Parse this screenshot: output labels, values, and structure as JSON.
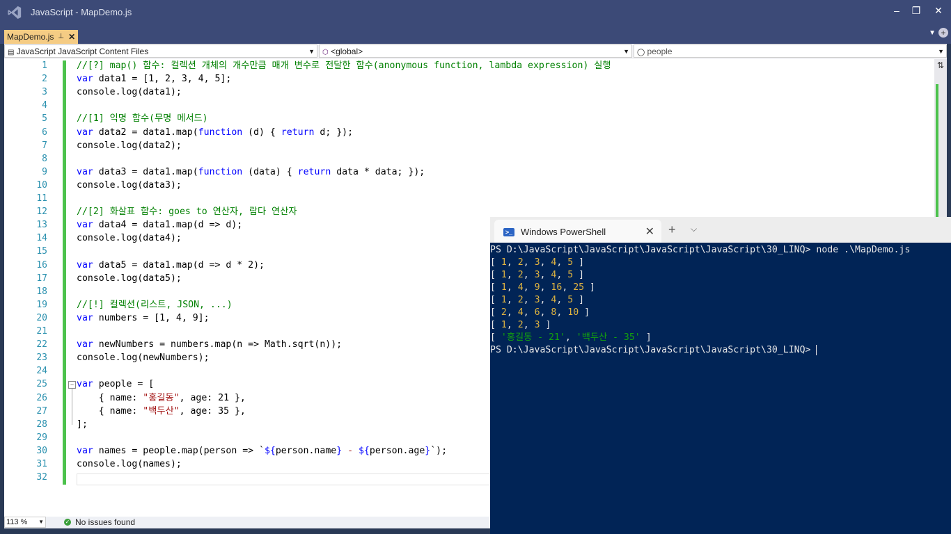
{
  "window": {
    "title": "JavaScript - MapDemo.js"
  },
  "tab": {
    "label": "MapDemo.js",
    "pin": "⊥",
    "close": "✕"
  },
  "navbar": {
    "project": "JavaScript JavaScript Content Files",
    "scope": "<global>",
    "member": "people"
  },
  "editor": {
    "line_numbers": [
      "1",
      "2",
      "3",
      "4",
      "5",
      "6",
      "7",
      "8",
      "9",
      "10",
      "11",
      "12",
      "13",
      "14",
      "15",
      "16",
      "17",
      "18",
      "19",
      "20",
      "21",
      "22",
      "23",
      "24",
      "25",
      "26",
      "27",
      "28",
      "29",
      "30",
      "31",
      "32"
    ],
    "lines": [
      {
        "parts": [
          {
            "t": "//[?] map() 함수: 컬렉션 개체의 개수만큼 매개 변수로 전달한 함수(anonymous function, lambda expression) 실행",
            "c": "cm"
          }
        ]
      },
      {
        "parts": [
          {
            "t": "var",
            "c": "kw"
          },
          {
            "t": " data1 = [1, 2, 3, 4, 5];"
          }
        ]
      },
      {
        "parts": [
          {
            "t": "console.log(data1);"
          }
        ]
      },
      {
        "parts": []
      },
      {
        "parts": [
          {
            "t": "//[1] 익명 함수(무명 메서드)",
            "c": "cm"
          }
        ]
      },
      {
        "parts": [
          {
            "t": "var",
            "c": "kw"
          },
          {
            "t": " data2 = data1.map("
          },
          {
            "t": "function",
            "c": "kw"
          },
          {
            "t": " (d) { "
          },
          {
            "t": "return",
            "c": "kw"
          },
          {
            "t": " d; });"
          }
        ]
      },
      {
        "parts": [
          {
            "t": "console.log(data2);"
          }
        ]
      },
      {
        "parts": []
      },
      {
        "parts": [
          {
            "t": "var",
            "c": "kw"
          },
          {
            "t": " data3 = data1.map("
          },
          {
            "t": "function",
            "c": "kw"
          },
          {
            "t": " (data) { "
          },
          {
            "t": "return",
            "c": "kw"
          },
          {
            "t": " data * data; });"
          }
        ]
      },
      {
        "parts": [
          {
            "t": "console.log(data3);"
          }
        ]
      },
      {
        "parts": []
      },
      {
        "parts": [
          {
            "t": "//[2] 화살표 함수: goes to 연산자, 람다 연산자",
            "c": "cm"
          }
        ]
      },
      {
        "parts": [
          {
            "t": "var",
            "c": "kw"
          },
          {
            "t": " data4 = data1.map(d => d);"
          }
        ]
      },
      {
        "parts": [
          {
            "t": "console.log(data4);"
          }
        ]
      },
      {
        "parts": []
      },
      {
        "parts": [
          {
            "t": "var",
            "c": "kw"
          },
          {
            "t": " data5 = data1.map(d => d * 2);"
          }
        ]
      },
      {
        "parts": [
          {
            "t": "console.log(data5);"
          }
        ]
      },
      {
        "parts": []
      },
      {
        "parts": [
          {
            "t": "//[!] 컬렉션(리스트, JSON, ...)",
            "c": "cm"
          }
        ]
      },
      {
        "parts": [
          {
            "t": "var",
            "c": "kw"
          },
          {
            "t": " numbers = [1, 4, 9];"
          }
        ]
      },
      {
        "parts": []
      },
      {
        "parts": [
          {
            "t": "var",
            "c": "kw"
          },
          {
            "t": " newNumbers = numbers.map(n => Math.sqrt(n));"
          }
        ]
      },
      {
        "parts": [
          {
            "t": "console.log(newNumbers);"
          }
        ]
      },
      {
        "parts": []
      },
      {
        "parts": [
          {
            "t": "var",
            "c": "kw"
          },
          {
            "t": " people = ["
          }
        ]
      },
      {
        "parts": [
          {
            "t": "    { name: "
          },
          {
            "t": "\"홍길동\"",
            "c": "st"
          },
          {
            "t": ", age: 21 },"
          }
        ]
      },
      {
        "parts": [
          {
            "t": "    { name: "
          },
          {
            "t": "\"백두산\"",
            "c": "st"
          },
          {
            "t": ", age: 35 },"
          }
        ]
      },
      {
        "parts": [
          {
            "t": "];"
          }
        ]
      },
      {
        "parts": []
      },
      {
        "parts": [
          {
            "t": "var",
            "c": "kw"
          },
          {
            "t": " names = people.map(person => `"
          },
          {
            "t": "${",
            "c": "kw"
          },
          {
            "t": "person.name"
          },
          {
            "t": "}",
            "c": "kw"
          },
          {
            "t": " - ",
            "c": "st"
          },
          {
            "t": "${",
            "c": "kw"
          },
          {
            "t": "person.age"
          },
          {
            "t": "}",
            "c": "kw"
          },
          {
            "t": "`);"
          }
        ]
      },
      {
        "parts": [
          {
            "t": "console.log(names);"
          }
        ]
      },
      {
        "parts": []
      }
    ]
  },
  "status": {
    "zoom": "113 %",
    "issues": "No issues found"
  },
  "terminal": {
    "tab_title": "Windows PowerShell",
    "lines": [
      {
        "parts": [
          {
            "t": "PS D:\\JavaScript\\JavaScript\\JavaScript\\JavaScript\\30_LINQ> node .\\MapDemo.js"
          }
        ]
      },
      {
        "parts": [
          {
            "t": "[ "
          },
          {
            "t": "1",
            "c": "num"
          },
          {
            "t": ", "
          },
          {
            "t": "2",
            "c": "num"
          },
          {
            "t": ", "
          },
          {
            "t": "3",
            "c": "num"
          },
          {
            "t": ", "
          },
          {
            "t": "4",
            "c": "num"
          },
          {
            "t": ", "
          },
          {
            "t": "5",
            "c": "num"
          },
          {
            "t": " ]"
          }
        ]
      },
      {
        "parts": [
          {
            "t": "[ "
          },
          {
            "t": "1",
            "c": "num"
          },
          {
            "t": ", "
          },
          {
            "t": "2",
            "c": "num"
          },
          {
            "t": ", "
          },
          {
            "t": "3",
            "c": "num"
          },
          {
            "t": ", "
          },
          {
            "t": "4",
            "c": "num"
          },
          {
            "t": ", "
          },
          {
            "t": "5",
            "c": "num"
          },
          {
            "t": " ]"
          }
        ]
      },
      {
        "parts": [
          {
            "t": "[ "
          },
          {
            "t": "1",
            "c": "num"
          },
          {
            "t": ", "
          },
          {
            "t": "4",
            "c": "num"
          },
          {
            "t": ", "
          },
          {
            "t": "9",
            "c": "num"
          },
          {
            "t": ", "
          },
          {
            "t": "16",
            "c": "num"
          },
          {
            "t": ", "
          },
          {
            "t": "25",
            "c": "num"
          },
          {
            "t": " ]"
          }
        ]
      },
      {
        "parts": [
          {
            "t": "[ "
          },
          {
            "t": "1",
            "c": "num"
          },
          {
            "t": ", "
          },
          {
            "t": "2",
            "c": "num"
          },
          {
            "t": ", "
          },
          {
            "t": "3",
            "c": "num"
          },
          {
            "t": ", "
          },
          {
            "t": "4",
            "c": "num"
          },
          {
            "t": ", "
          },
          {
            "t": "5",
            "c": "num"
          },
          {
            "t": " ]"
          }
        ]
      },
      {
        "parts": [
          {
            "t": "[ "
          },
          {
            "t": "2",
            "c": "num"
          },
          {
            "t": ", "
          },
          {
            "t": "4",
            "c": "num"
          },
          {
            "t": ", "
          },
          {
            "t": "6",
            "c": "num"
          },
          {
            "t": ", "
          },
          {
            "t": "8",
            "c": "num"
          },
          {
            "t": ", "
          },
          {
            "t": "10",
            "c": "num"
          },
          {
            "t": " ]"
          }
        ]
      },
      {
        "parts": [
          {
            "t": "[ "
          },
          {
            "t": "1",
            "c": "num"
          },
          {
            "t": ", "
          },
          {
            "t": "2",
            "c": "num"
          },
          {
            "t": ", "
          },
          {
            "t": "3",
            "c": "num"
          },
          {
            "t": " ]"
          }
        ]
      },
      {
        "parts": [
          {
            "t": "[ "
          },
          {
            "t": "'홍길동 - 21'",
            "c": "str"
          },
          {
            "t": ", "
          },
          {
            "t": "'백두산 - 35'",
            "c": "str"
          },
          {
            "t": " ]"
          }
        ]
      },
      {
        "parts": [
          {
            "t": "PS D:\\JavaScript\\JavaScript\\JavaScript\\JavaScript\\30_LINQ> "
          }
        ],
        "cursor": true
      }
    ]
  }
}
